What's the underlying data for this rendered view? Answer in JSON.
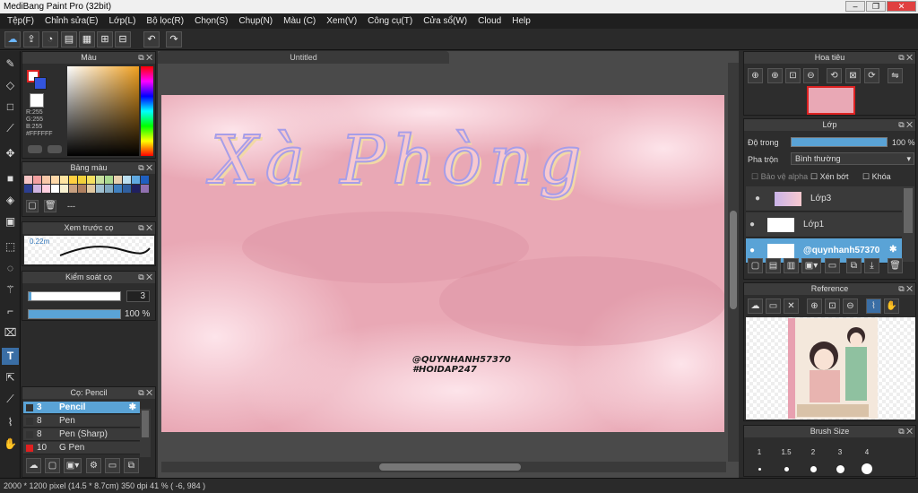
{
  "window": {
    "title": "MediBang Paint Pro (32bit)"
  },
  "menu": [
    "Tệp(F)",
    "Chỉnh sửa(E)",
    "Lớp(L)",
    "Bộ lọc(R)",
    "Chọn(S)",
    "Chụp(N)",
    "Màu (C)",
    "Xem(V)",
    "Công cụ(T)",
    "Cửa sổ(W)",
    "Cloud",
    "Help"
  ],
  "canvas": {
    "tab": "Untitled",
    "title_text": "Xà Phòng",
    "watermark_line1": "@QUYNHANH57370",
    "watermark_line2": "#HOIDAP247"
  },
  "color_panel": {
    "title": "Màu",
    "r": "R:255",
    "g": "G:255",
    "b": "B:255",
    "hex": "#FFFFFF"
  },
  "palette": {
    "title": "Bảng màu",
    "colors": [
      "#f5c4c4",
      "#f4a0a0",
      "#f8c8a8",
      "#ffd8a8",
      "#ffe4a0",
      "#ffcf40",
      "#f2d13a",
      "#f5e060",
      "#c8e0a0",
      "#a8d890",
      "#e8d0b0",
      "#bcdff0",
      "#5fa8e0",
      "#1f5fc0",
      "#2c3e90",
      "#d0b4e0",
      "#ffd0e0",
      "#fff",
      "#f8f0d0",
      "#c8a080",
      "#b08060",
      "#e0c8a0",
      "#a0c0d0",
      "#80a8c0",
      "#4080c0",
      "#3060a0",
      "#202060",
      "#9070b0"
    ],
    "more": "---"
  },
  "brush_preview": {
    "title": "Xem trước cọ",
    "size": "0.22m"
  },
  "brush_control": {
    "title": "Kiểm soát cọ",
    "size_value": "3",
    "opacity_value": "100 %",
    "opacity": 1.0
  },
  "brushes": {
    "title": "Cọ: Pencil",
    "items": [
      {
        "size": "3",
        "name": "Pencil",
        "color": "#333"
      },
      {
        "size": "8",
        "name": "Pen",
        "color": "#333"
      },
      {
        "size": "8",
        "name": "Pen (Sharp)",
        "color": "#333"
      },
      {
        "size": "10",
        "name": "G Pen",
        "color": "#e02020"
      }
    ]
  },
  "navigator": {
    "title": "Hoa tiêu"
  },
  "layers": {
    "title": "Lớp",
    "opacity_label": "Độ trong",
    "opacity_value": "100 %",
    "blend_label": "Pha trộn",
    "blend_value": "Bình thường",
    "protect_alpha": "Bảo vệ alpha",
    "clip": "Xén bớt",
    "lock": "Khóa",
    "items": [
      {
        "name": "Lớp3"
      },
      {
        "name": "Lớp1"
      },
      {
        "name": "@quynhanh57370"
      }
    ]
  },
  "reference": {
    "title": "Reference"
  },
  "brush_size": {
    "title": "Brush Size",
    "sizes": [
      "1",
      "1.5",
      "2",
      "3",
      "4"
    ]
  },
  "status": {
    "text": "2000 * 1200 pixel   (14.5 * 8.7cm)  350 dpi   41 %   ( -6, 984 )"
  }
}
